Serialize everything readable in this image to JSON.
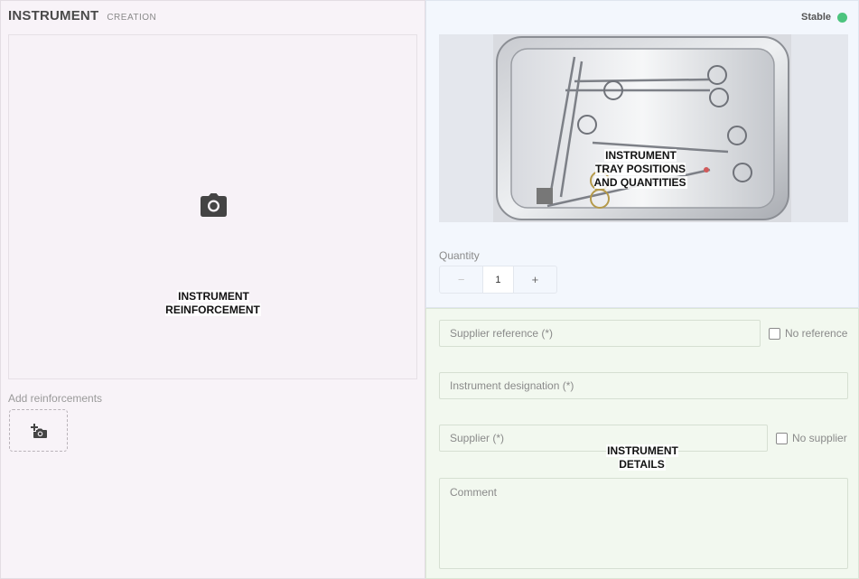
{
  "header": {
    "title": "INSTRUMENT",
    "subtitle": "CREATION"
  },
  "left": {
    "photo_overlay_label": "INSTRUMENT\nREINFORCEMENT",
    "add_reinforcements_label": "Add reinforcements"
  },
  "status": {
    "text": "Stable",
    "color": "#4cc47e"
  },
  "tray": {
    "overlay_label": "INSTRUMENT\nTRAY POSITIONS\nAND QUANTITIES"
  },
  "quantity": {
    "label": "Quantity",
    "decrement": "−",
    "value": "1",
    "increment": "+"
  },
  "details": {
    "overlay_label": "INSTRUMENT\nDETAILS",
    "supplier_reference_placeholder": "Supplier reference (*)",
    "no_reference_label": "No reference",
    "designation_placeholder": "Instrument designation (*)",
    "supplier_placeholder": "Supplier (*)",
    "no_supplier_label": "No supplier",
    "comment_placeholder": "Comment"
  },
  "icons": {
    "camera": "camera-icon",
    "add_photo": "add-photo-icon"
  }
}
